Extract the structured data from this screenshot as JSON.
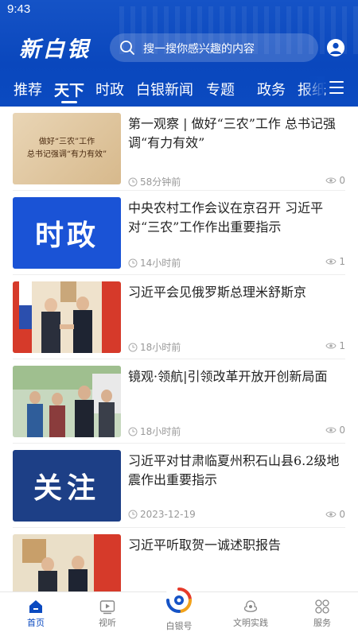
{
  "status_bar": {
    "time": "9:43"
  },
  "header": {
    "logo": "新白银",
    "search_placeholder": "搜一搜你感兴趣的内容",
    "tabs": [
      {
        "label": "推荐",
        "active": false
      },
      {
        "label": "天下",
        "active": true
      },
      {
        "label": "时政",
        "active": false
      },
      {
        "label": "白银新闻",
        "active": false
      },
      {
        "label": "专题",
        "active": false
      },
      {
        "label": "政务",
        "active": false
      },
      {
        "label": "报纸",
        "active": false
      }
    ]
  },
  "feed": {
    "items": [
      {
        "title": "第一观察 | 做好“三农”工作 总书记强调“有力有效”",
        "time": "58分钟前",
        "views": "0",
        "thumb_text": "做好“三农”工作\n总书记强调“有力有效”"
      },
      {
        "title": "中央农村工作会议在京召开 习近平对“三农”工作作出重要指示",
        "time": "14小时前",
        "views": "1",
        "thumb_text": "时政"
      },
      {
        "title": "习近平会见俄罗斯总理米舒斯京",
        "time": "18小时前",
        "views": "1"
      },
      {
        "title": "镜观·领航|引领改革开放开创新局面",
        "time": "18小时前",
        "views": "0"
      },
      {
        "title": "习近平对甘肃临夏州积石山县6.2级地震作出重要指示",
        "time": "2023-12-19",
        "views": "0",
        "thumb_text": "关注"
      },
      {
        "title": "习近平听取贺一诚述职报告"
      }
    ]
  },
  "bottom_nav": {
    "items": [
      {
        "label": "首页",
        "icon": "home-icon",
        "active": true
      },
      {
        "label": "视听",
        "icon": "video-icon",
        "active": false
      },
      {
        "label": "白银号",
        "icon": "baiyin-logo-icon",
        "active": false
      },
      {
        "label": "文明实践",
        "icon": "civilization-icon",
        "active": false
      },
      {
        "label": "服务",
        "icon": "services-icon",
        "active": false
      }
    ]
  },
  "colors": {
    "brand": "#0b4ac0",
    "text": "#222222",
    "muted": "#999999"
  }
}
